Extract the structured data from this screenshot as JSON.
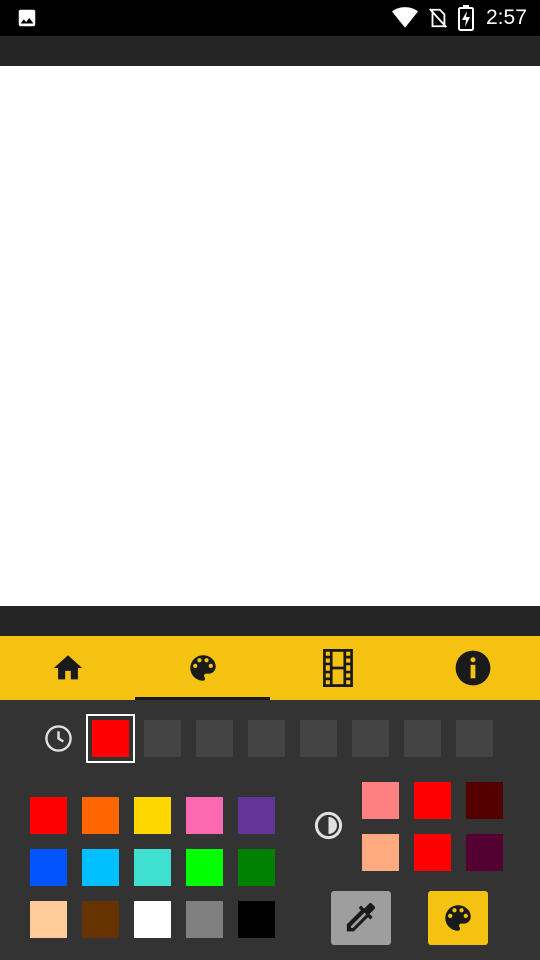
{
  "status_bar": {
    "time": "2:57",
    "icons": [
      "image-icon",
      "wifi-icon",
      "no-sim-icon",
      "battery-charging-icon"
    ]
  },
  "colors": {
    "accent": "#F5C211",
    "panel_bg": "#333333",
    "canvas": "#FFFFFF",
    "empty_slot": "#444444",
    "icon_dark": "#1A1A1A"
  },
  "tabs": [
    {
      "icon": "home-icon",
      "active": false
    },
    {
      "icon": "palette-icon",
      "active": true
    },
    {
      "icon": "film-icon",
      "active": false
    },
    {
      "icon": "info-icon",
      "active": false
    }
  ],
  "recent_colors": [
    "#FF0000",
    null,
    null,
    null,
    null,
    null,
    null,
    null
  ],
  "palette_swatches": [
    [
      "#FF0000",
      "#FF6600",
      "#FFD700",
      "#FF69B4",
      "#663399"
    ],
    [
      "#0055FF",
      "#00BFFF",
      "#40E0D0",
      "#00FF00",
      "#008000"
    ],
    [
      "#FFCC99",
      "#663300",
      "#FFFFFF",
      "#808080",
      "#000000"
    ]
  ],
  "shade_swatches": [
    [
      "#FF8080",
      "#FF0000",
      "#550000"
    ],
    [
      "#FFAA80",
      "#FF0000",
      "#550033"
    ]
  ],
  "buttons": [
    {
      "icon": "eyedropper-icon",
      "background": "#9E9E9E"
    },
    {
      "icon": "palette-icon",
      "background": "#F5C211"
    }
  ]
}
